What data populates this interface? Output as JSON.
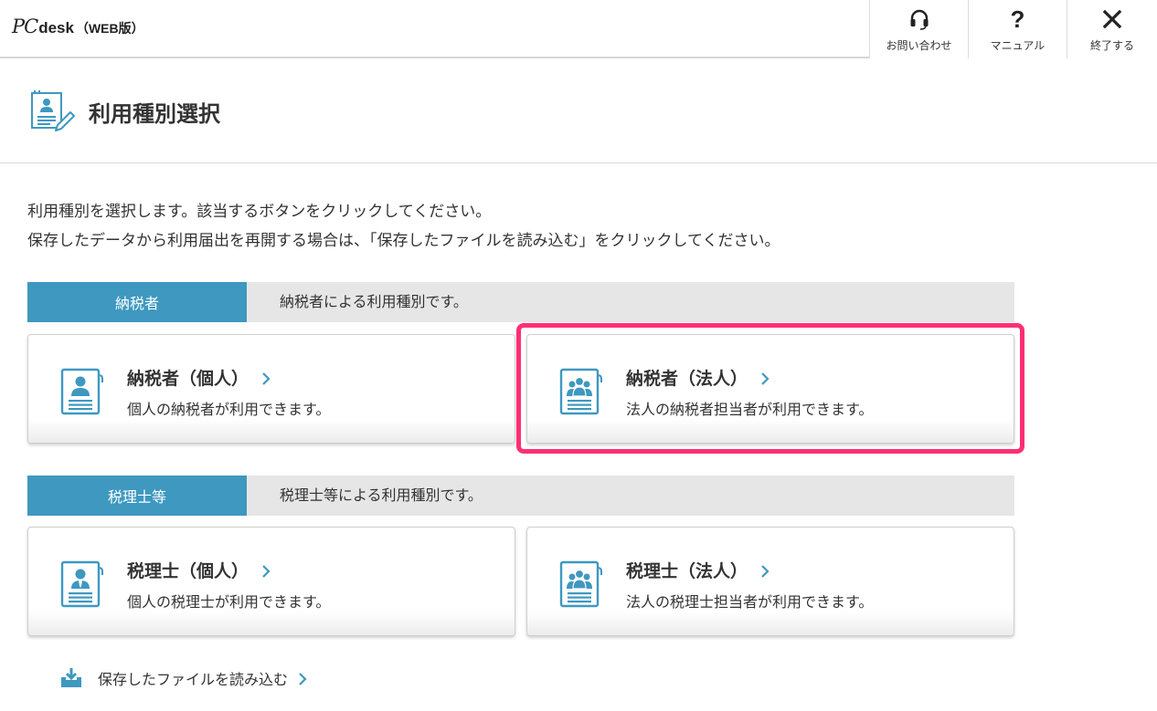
{
  "header": {
    "logo_pc": "PC",
    "logo_desk": "desk",
    "logo_web": "（WEB版）",
    "buttons": {
      "contact": {
        "label": "お問い合わせ",
        "icon": "headset-icon"
      },
      "manual": {
        "label": "マニュアル",
        "icon": "question-icon"
      },
      "exit": {
        "label": "終了する",
        "icon": "close-icon"
      }
    }
  },
  "page": {
    "title": "利用種別選択",
    "title_icon": "document-edit-icon",
    "intro_line1": "利用種別を選択します。該当するボタンをクリックしてください。",
    "intro_line2": "保存したデータから利用届出を再開する場合は、「保存したファイルを読み込む」をクリックしてください。"
  },
  "sections": {
    "taxpayer": {
      "tag": "納税者",
      "description": "納税者による利用種別です。",
      "cards": [
        {
          "title": "納税者（個人）",
          "description": "個人の納税者が利用できます。",
          "icon": "person-card-icon"
        },
        {
          "title": "納税者（法人）",
          "description": "法人の納税者担当者が利用できます。",
          "icon": "group-card-icon",
          "highlighted": true
        }
      ]
    },
    "accountant": {
      "tag": "税理士等",
      "description": "税理士等による利用種別です。",
      "cards": [
        {
          "title": "税理士（個人）",
          "description": "個人の税理士が利用できます。",
          "icon": "person-tie-card-icon"
        },
        {
          "title": "税理士（法人）",
          "description": "法人の税理士担当者が利用できます。",
          "icon": "group-card-icon"
        }
      ]
    }
  },
  "load_file": {
    "label": "保存したファイルを読み込む",
    "icon": "download-tray-icon"
  },
  "colors": {
    "accent": "#3e98c0",
    "highlight": "#ff2f74",
    "section_bg": "#e6e6e6",
    "text": "#333333"
  }
}
